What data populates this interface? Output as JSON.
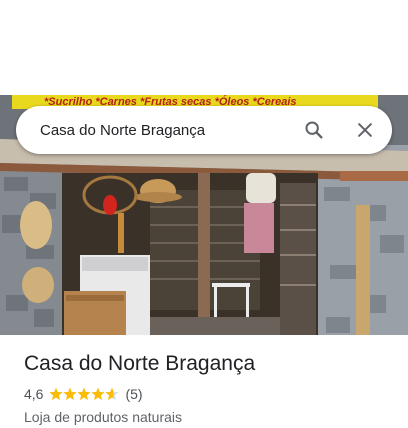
{
  "search": {
    "value": "Casa do Norte Bragança",
    "search_icon": "search-icon",
    "close_icon": "close-icon"
  },
  "photo": {
    "sign_text": "*Sucrilho *Carnes *Frutas secas *Óleos *Cereais"
  },
  "place": {
    "name": "Casa do Norte Bragança",
    "rating": "4,6",
    "rating_stars": 4.6,
    "review_count": "(5)",
    "category": "Loja de produtos naturais",
    "star_color": "#fbbc04"
  }
}
